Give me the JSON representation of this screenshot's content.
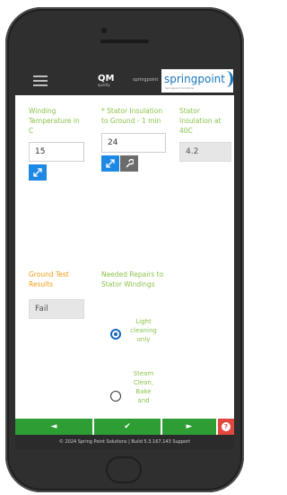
{
  "header": {
    "qm_logo": "QM",
    "qm_logo_sub": "quality",
    "small_mark": "springpoint",
    "brand": "springpoint",
    "brand_sub": "Springpoint Solutions"
  },
  "fields": {
    "winding_temp_label": "Winding Temperature in C",
    "winding_temp_value": "15",
    "stator_ground_label": "* Stator Insulation to Ground - 1 min",
    "stator_ground_value": "24",
    "stator_40c_label": "Stator Insulation at 40C",
    "stator_40c_value": "4.2",
    "ground_test_label": "Ground Test Results",
    "ground_test_value": "Fail",
    "needed_repairs_label": "Needed Repairs to Stator Windings"
  },
  "radio_options": [
    {
      "label_lines": [
        "Light",
        "cleaning",
        "only"
      ],
      "checked": true
    },
    {
      "label_lines": [
        "Steam",
        "Clean,",
        "Bake",
        "and"
      ],
      "checked": false
    }
  ],
  "nav": {
    "prev": "◄",
    "save": "✔",
    "next": "►",
    "help": "?"
  },
  "footer": {
    "text": "© 2024 Spring Point Solutions | Build 5.3.167.143 Support"
  },
  "colors": {
    "label_green": "#8bc34a",
    "label_orange": "#f39c12",
    "action_blue": "#1e88e5",
    "nav_green": "#2e9d34",
    "help_red": "#e0483e"
  },
  "icons": {
    "expand": "expand-icon",
    "wrench": "wrench-icon",
    "menu": "hamburger-icon"
  }
}
